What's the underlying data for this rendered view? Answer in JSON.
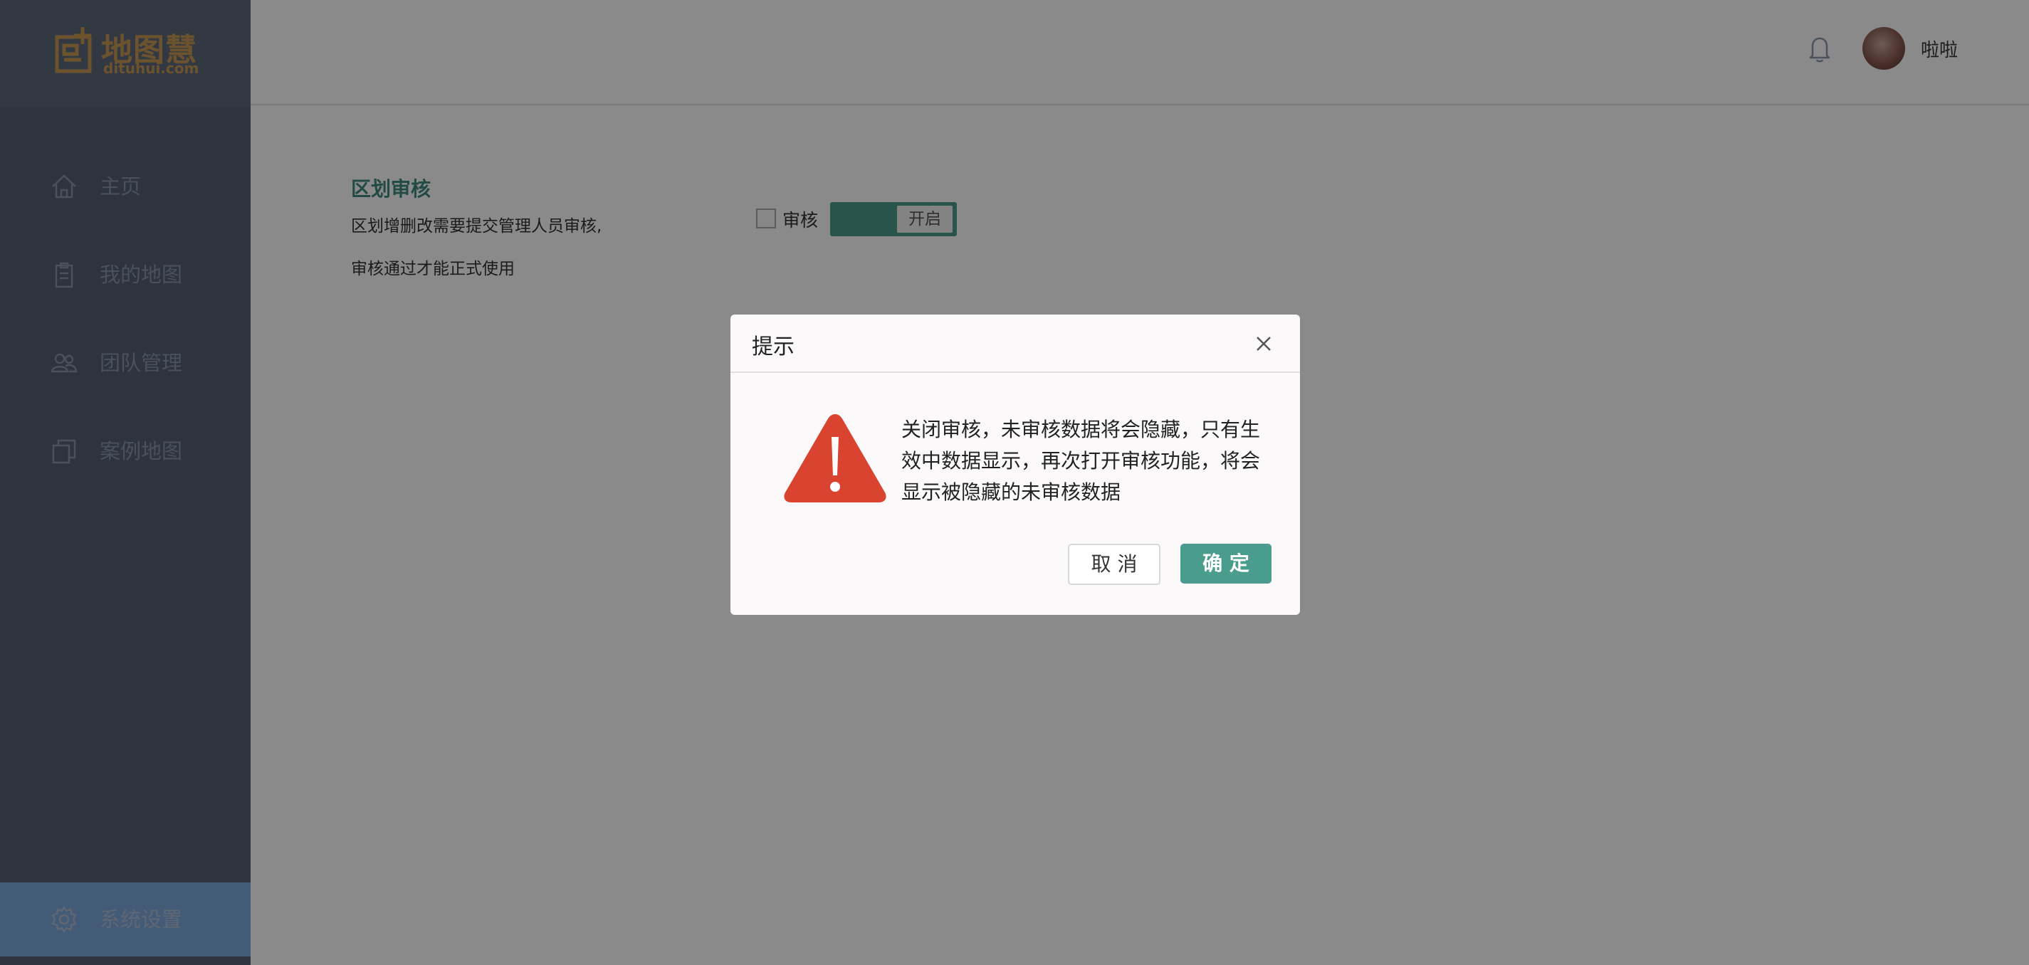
{
  "logo": {
    "title": "地图慧",
    "domain": "dituhui.com"
  },
  "sidebar": {
    "items": [
      {
        "label": "主页",
        "icon": "home-icon"
      },
      {
        "label": "我的地图",
        "icon": "clipboard-icon"
      },
      {
        "label": "团队管理",
        "icon": "team-icon"
      },
      {
        "label": "案例地图",
        "icon": "copy-icon"
      }
    ],
    "settings": {
      "label": "系统设置",
      "icon": "gear-icon"
    }
  },
  "header": {
    "username": "啦啦",
    "icons": [
      "bell-icon",
      "avatar"
    ]
  },
  "content": {
    "section_title": "区划审核",
    "description_line1": "区划增删改需要提交管理人员审核,",
    "description_line2": "审核通过才能正式使用",
    "audit_label": "审核",
    "toggle_text": "开启"
  },
  "dialog": {
    "title": "提示",
    "message": "关闭审核，未审核数据将会隐藏，只有生效中数据显示，再次打开审核功能，将会显示被隐藏的未审核数据",
    "cancel_label": "取 消",
    "ok_label": "确 定",
    "icon": "warning-icon"
  },
  "colors": {
    "accent": "#4a9c8d",
    "sidebar": "#536073",
    "sidebar_active": "#7fa9dc",
    "logo": "#c79a55",
    "warning": "#d9432f"
  }
}
